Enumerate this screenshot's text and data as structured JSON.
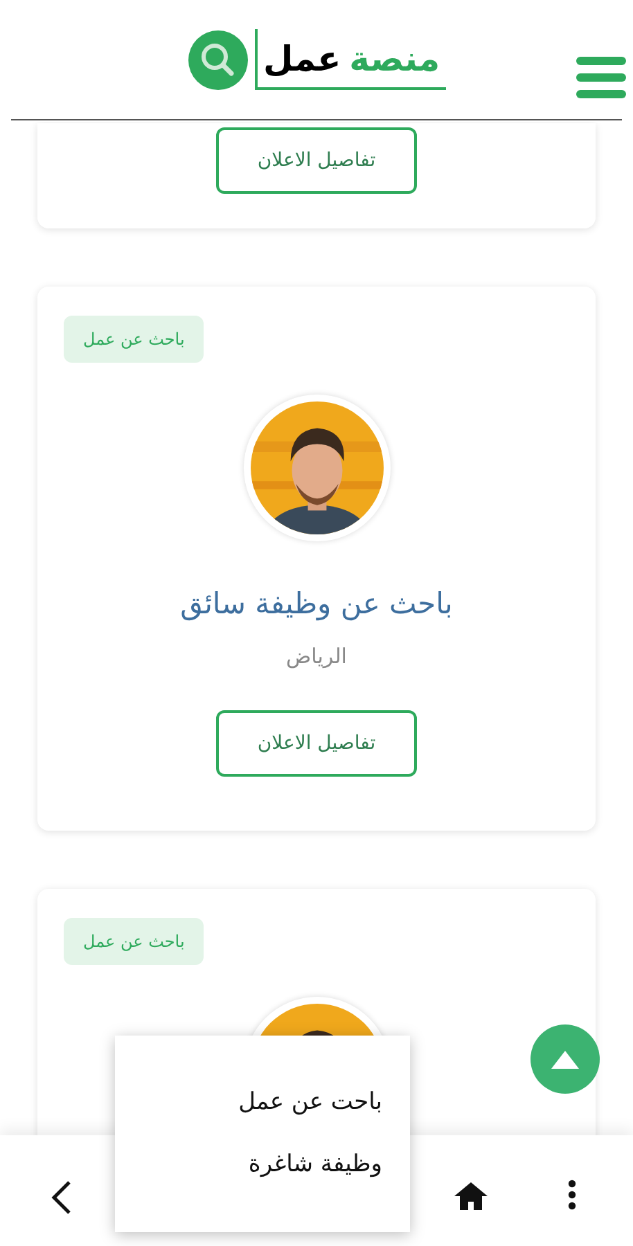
{
  "header": {
    "logo_text_1": "منصة",
    "logo_text_2": "عمل"
  },
  "cards": [
    {
      "button": "تفاصيل الاعلان"
    },
    {
      "badge": "باحث عن عمل",
      "title": "باحث عن وظيفة سائق",
      "location": "الرياض",
      "button": "تفاصيل الاعلان"
    },
    {
      "badge": "باحث عن عمل"
    }
  ],
  "menu": {
    "items": [
      {
        "label": "باحت عن عمل"
      },
      {
        "label": "وظيفة شاغرة"
      }
    ]
  }
}
